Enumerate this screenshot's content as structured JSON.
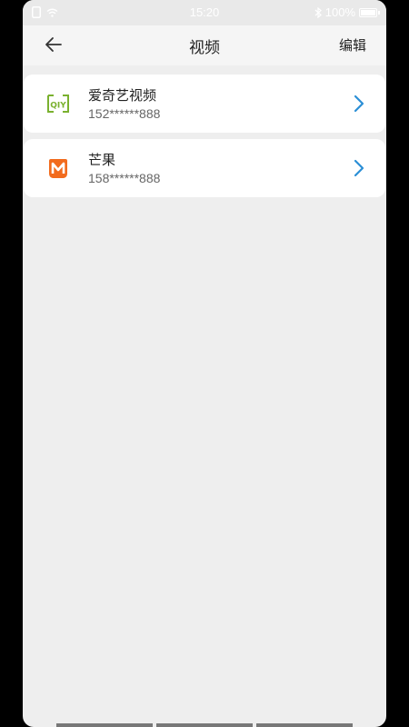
{
  "status_bar": {
    "time": "15:20",
    "battery": "100%"
  },
  "header": {
    "title": "视频",
    "edit_label": "编辑"
  },
  "accounts": [
    {
      "name": "爱奇艺视频",
      "account": "152******888",
      "logo": "iqiyi-logo",
      "brand_color": "#7ab12f"
    },
    {
      "name": "芒果",
      "account": "158******888",
      "logo": "mango-logo",
      "brand_color": "#f26b1d"
    }
  ],
  "colors": {
    "chevron": "#2b8fd6",
    "background": "#eeeeee"
  }
}
